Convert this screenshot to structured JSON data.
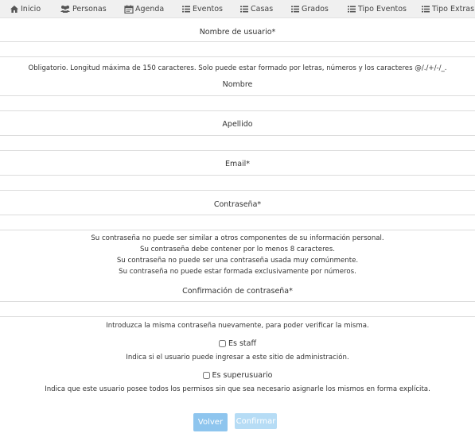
{
  "nav": {
    "items": [
      {
        "label": "Inicio",
        "icon": "home-icon"
      },
      {
        "label": "Personas",
        "icon": "users-icon"
      },
      {
        "label": "Agenda",
        "icon": "calendar-icon"
      },
      {
        "label": "Eventos",
        "icon": "list-icon"
      },
      {
        "label": "Casas",
        "icon": "list-icon"
      },
      {
        "label": "Grados",
        "icon": "list-icon"
      },
      {
        "label": "Tipo Eventos",
        "icon": "list-icon"
      },
      {
        "label": "Tipo Extras",
        "icon": "list-icon"
      }
    ]
  },
  "form": {
    "username": {
      "label": "Nombre de usuario*",
      "value": "",
      "help": "Obligatorio. Longitud máxima de 150 caracteres. Solo puede estar formado por letras, números y los caracteres @/./+/-/_."
    },
    "first_name": {
      "label": "Nombre",
      "value": ""
    },
    "last_name": {
      "label": "Apellido",
      "value": ""
    },
    "email": {
      "label": "Email*",
      "value": ""
    },
    "password": {
      "label": "Contraseña*",
      "value": "",
      "help": [
        "Su contraseña no puede ser similar a otros componentes de su información personal.",
        "Su contraseña debe contener por lo menos 8 caracteres.",
        "Su contraseña no puede ser una contraseña usada muy comúnmente.",
        "Su contraseña no puede estar formada exclusivamente por números."
      ]
    },
    "password_confirm": {
      "label": "Confirmación de contraseña*",
      "value": "",
      "help": "Introduzca la misma contraseña nuevamente, para poder verificar la misma."
    },
    "is_staff": {
      "label": "Es staff",
      "checked": false,
      "help": "Indica si el usuario puede ingresar a este sitio de administración."
    },
    "is_superuser": {
      "label": "Es superusuario",
      "checked": false,
      "help": "Indica que este usuario posee todos los permisos sin que sea necesario asignarle los mismos en forma explícita."
    },
    "back_button": "Volver",
    "submit_button": "Confirmar"
  },
  "colors": {
    "nav_bg": "#f0f0f0",
    "back_button": "#8ec5ee",
    "submit_button": "#b6dcf5"
  }
}
